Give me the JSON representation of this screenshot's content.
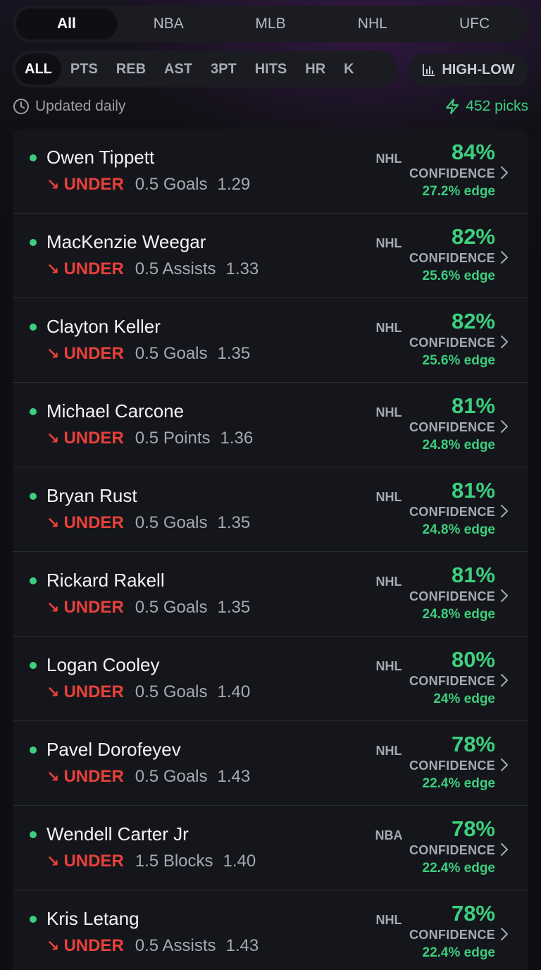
{
  "leagues": {
    "tabs": [
      "All",
      "NBA",
      "MLB",
      "NHL",
      "UFC"
    ],
    "active": "All"
  },
  "stats": {
    "tabs": [
      "ALL",
      "PTS",
      "REB",
      "AST",
      "3PT",
      "HITS",
      "HR",
      "K"
    ],
    "active": "ALL"
  },
  "sort": {
    "label": "HIGH-LOW",
    "icon": "bar-chart-icon"
  },
  "info": {
    "updated": "Updated daily",
    "updated_icon": "clock-icon",
    "picks": "452 picks",
    "picks_icon": "lightning-icon"
  },
  "colors": {
    "accent_green": "#3ccf7e",
    "under_red": "#e8413a"
  },
  "picks": [
    {
      "name": "Owen Tippett",
      "direction": "UNDER",
      "line": "0.5 Goals",
      "odds": "1.29",
      "league": "NHL",
      "confidence": "84%",
      "confidence_label": "CONFIDENCE",
      "edge": "27.2% edge"
    },
    {
      "name": "MacKenzie Weegar",
      "direction": "UNDER",
      "line": "0.5 Assists",
      "odds": "1.33",
      "league": "NHL",
      "confidence": "82%",
      "confidence_label": "CONFIDENCE",
      "edge": "25.6% edge"
    },
    {
      "name": "Clayton Keller",
      "direction": "UNDER",
      "line": "0.5 Goals",
      "odds": "1.35",
      "league": "NHL",
      "confidence": "82%",
      "confidence_label": "CONFIDENCE",
      "edge": "25.6% edge"
    },
    {
      "name": "Michael Carcone",
      "direction": "UNDER",
      "line": "0.5 Points",
      "odds": "1.36",
      "league": "NHL",
      "confidence": "81%",
      "confidence_label": "CONFIDENCE",
      "edge": "24.8% edge"
    },
    {
      "name": "Bryan Rust",
      "direction": "UNDER",
      "line": "0.5 Goals",
      "odds": "1.35",
      "league": "NHL",
      "confidence": "81%",
      "confidence_label": "CONFIDENCE",
      "edge": "24.8% edge"
    },
    {
      "name": "Rickard Rakell",
      "direction": "UNDER",
      "line": "0.5 Goals",
      "odds": "1.35",
      "league": "NHL",
      "confidence": "81%",
      "confidence_label": "CONFIDENCE",
      "edge": "24.8% edge"
    },
    {
      "name": "Logan Cooley",
      "direction": "UNDER",
      "line": "0.5 Goals",
      "odds": "1.40",
      "league": "NHL",
      "confidence": "80%",
      "confidence_label": "CONFIDENCE",
      "edge": "24% edge"
    },
    {
      "name": "Pavel Dorofeyev",
      "direction": "UNDER",
      "line": "0.5 Goals",
      "odds": "1.43",
      "league": "NHL",
      "confidence": "78%",
      "confidence_label": "CONFIDENCE",
      "edge": "22.4% edge"
    },
    {
      "name": "Wendell Carter Jr",
      "direction": "UNDER",
      "line": "1.5 Blocks",
      "odds": "1.40",
      "league": "NBA",
      "confidence": "78%",
      "confidence_label": "CONFIDENCE",
      "edge": "22.4% edge"
    },
    {
      "name": "Kris Letang",
      "direction": "UNDER",
      "line": "0.5 Assists",
      "odds": "1.43",
      "league": "NHL",
      "confidence": "78%",
      "confidence_label": "CONFIDENCE",
      "edge": "22.4% edge"
    }
  ]
}
